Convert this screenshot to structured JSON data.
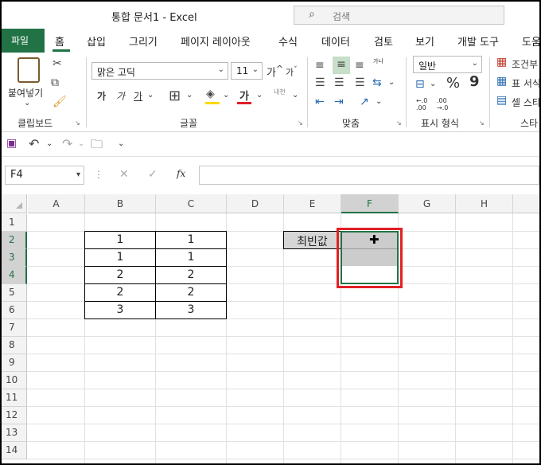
{
  "window": {
    "title": "통합 문서1  -  Excel"
  },
  "search": {
    "placeholder": "검색"
  },
  "tabs": [
    "파일",
    "홈",
    "삽입",
    "그리기",
    "페이지 레이아웃",
    "수식",
    "데이터",
    "검토",
    "보기",
    "개발 도구",
    "도움"
  ],
  "ribbon": {
    "clipboard": {
      "paste_label": "붙여넣기",
      "group_label": "클립보드"
    },
    "font": {
      "name": "맑은 고딕",
      "size": "11",
      "grow_label": "가",
      "shrink_label": "가",
      "bold": "가",
      "italic": "가",
      "underline": "가",
      "font_color_label": "가",
      "group_label": "글꼴",
      "phonetic_label": "내천"
    },
    "alignment": {
      "group_label": "맞춤",
      "wrap_label": "가나"
    },
    "number": {
      "format": "일반",
      "percent": "%",
      "comma": "9",
      "group_label": "표시 형식",
      "inc_decimal": "←.0 .00",
      "dec_decimal": ".00 →.0"
    },
    "styles": {
      "conditional": "조건부",
      "table": "표 서식",
      "cell": "셀 스타",
      "group_label": "스타"
    }
  },
  "formula_bar": {
    "name_box": "F4",
    "cancel": "✕",
    "enter": "✓",
    "fx": "fx",
    "formula": ""
  },
  "grid": {
    "columns": [
      "A",
      "B",
      "C",
      "D",
      "E",
      "F",
      "G",
      "H"
    ],
    "rows": [
      "1",
      "2",
      "3",
      "4",
      "5",
      "6",
      "7",
      "8",
      "9",
      "10",
      "11",
      "12",
      "13",
      "14"
    ],
    "table": [
      [
        "1",
        "1"
      ],
      [
        "1",
        "1"
      ],
      [
        "2",
        "2"
      ],
      [
        "2",
        "2"
      ],
      [
        "3",
        "3"
      ]
    ],
    "mode_label": "최빈값",
    "active_column": "F",
    "selected_rows": [
      "2",
      "3",
      "4"
    ],
    "highlight_color": "#e21f26"
  }
}
